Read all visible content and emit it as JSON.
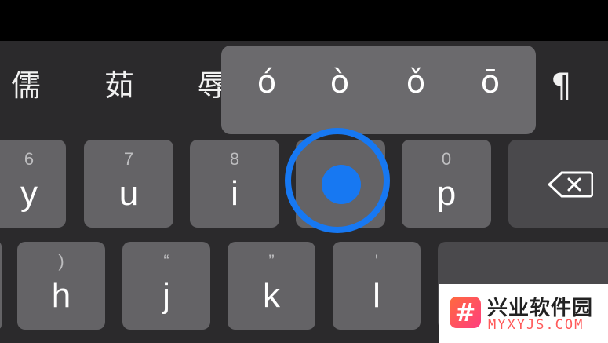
{
  "candidates": [
    "儒",
    "茹",
    "辱"
  ],
  "paragraph_key": "¶",
  "accent_popup": [
    "ó",
    "ò",
    "ǒ",
    "ō"
  ],
  "row1": [
    {
      "hint": "6",
      "label": "y"
    },
    {
      "hint": "7",
      "label": "u"
    },
    {
      "hint": "8",
      "label": "i"
    },
    {
      "hint": "0",
      "label": "p"
    }
  ],
  "row2": [
    {
      "hint": ")",
      "label": "h"
    },
    {
      "hint": "“",
      "label": "j"
    },
    {
      "hint": "”",
      "label": "k"
    },
    {
      "hint": "'",
      "label": "l"
    }
  ],
  "delete_icon": "backspace-icon",
  "touch_color": "#1778f2",
  "watermark": {
    "name": "兴业软件园",
    "domain": "MYXYJS.COM",
    "logo": "#"
  }
}
